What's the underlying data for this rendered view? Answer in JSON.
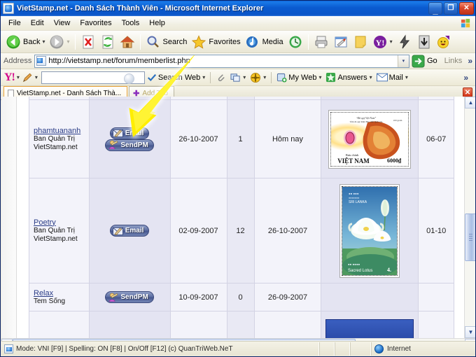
{
  "window": {
    "title": "VietStamp.net - Danh Sách Thành Viên - Microsoft Internet Explorer",
    "app_icon": "ie-page-icon",
    "minimize_label": "_",
    "restore_label": "❐",
    "close_label": "✕"
  },
  "menu": {
    "items": [
      {
        "label": "File"
      },
      {
        "label": "Edit"
      },
      {
        "label": "View"
      },
      {
        "label": "Favorites"
      },
      {
        "label": "Tools"
      },
      {
        "label": "Help"
      }
    ],
    "flag_icon": "windows-flag-icon"
  },
  "toolbar": {
    "back_label": "Back",
    "back_icon": "back-arrow-icon",
    "forward_icon": "forward-arrow-icon",
    "stop_icon": "stop-icon",
    "refresh_icon": "refresh-icon",
    "home_icon": "home-icon",
    "search_label": "Search",
    "search_icon": "magnifier-icon",
    "favorites_label": "Favorites",
    "favorites_icon": "star-icon",
    "media_label": "Media",
    "media_icon": "media-icon",
    "history_icon": "history-icon",
    "print_icon": "printer-icon",
    "edit_icon": "edit-page-icon",
    "note_icon": "note-icon",
    "yahoo_icon": "yahoo-icon",
    "messenger_icon": "messenger-icon",
    "download_icon": "download-icon",
    "emoticon_icon": "smiley-icon",
    "dropdown_caret": "▾"
  },
  "address": {
    "label": "Address",
    "url": "http://vietstamp.net/forum/memberlist.php",
    "page_icon": "page-icon",
    "dropdown_caret": "▾",
    "go_label": "Go",
    "go_icon": "go-arrow-icon",
    "links_label": "Links",
    "overflow_caret": "»"
  },
  "yahoo_toolbar": {
    "logo": "Y!",
    "logo_caret": "▾",
    "pencil_icon": "pencil-icon",
    "pencil_caret": "▾",
    "search_value": "",
    "search_placeholder": "",
    "check_icon": "check-icon",
    "search_web_label": "Search Web",
    "search_web_caret": "▾",
    "clip_icon": "paperclip-icon",
    "popup_icon": "popup-blocker-icon",
    "popup_caret": "▾",
    "antispy_icon": "anti-spy-icon",
    "antispy_caret": "▾",
    "myweb_label": "My Web",
    "myweb_icon": "myweb-icon",
    "myweb_caret": "▾",
    "answers_label": "Answers",
    "answers_icon": "answers-icon",
    "answers_caret": "▾",
    "mail_label": "Mail",
    "mail_icon": "mail-icon",
    "mail_caret": "▾",
    "overflow_caret": "»"
  },
  "tabstrip": {
    "tabs": [
      {
        "label": "VietStamp.net - Danh Sách Thà...",
        "active": true,
        "icon": "page-icon"
      },
      {
        "label": "Add Tab",
        "active": false,
        "icon": "plus-icon"
      }
    ],
    "close_label": "✕"
  },
  "memberlist": {
    "rows": [
      {
        "username": "phamtuananh",
        "role_line1": "Ban Quản Trị",
        "role_line2": "VietStamp.net",
        "actions": [
          {
            "label": "Email",
            "icon": "email-icon"
          },
          {
            "label": "SendPM",
            "icon": "sendpm-icon"
          }
        ],
        "join_date": "26-10-2007",
        "posts": "1",
        "last_visit": "Hôm nay",
        "stamp_alt": "vietnam-ruby-stamp",
        "stamp_caption_top": "\"Đá quý Việt Nam\"",
        "stamp_caption_sub": "Tem đá quý Rubi Bảo chất Quốc gia",
        "stamp_weight": "100 gram",
        "stamp_issuer": "Bưu chính",
        "stamp_country": "VIỆT NAM",
        "stamp_value": "6000₫",
        "number": "06-07"
      },
      {
        "username": "Poetry",
        "role_line1": "Ban Quản Trị",
        "role_line2": "VietStamp.net",
        "actions": [
          {
            "label": "Email",
            "icon": "email-icon"
          }
        ],
        "join_date": "02-09-2007",
        "posts": "12",
        "last_visit": "26-10-2007",
        "stamp_alt": "sri-lanka-sacred-lotus-stamp",
        "stamp_country": "SRI LANKA",
        "stamp_caption_bottom": "Sacred Lotus",
        "stamp_value": "4.50",
        "number": "01-10"
      },
      {
        "username": "Relax",
        "role_line1": "Tem Sống",
        "role_line2": "",
        "actions": [
          {
            "label": "SendPM",
            "icon": "sendpm-icon"
          }
        ],
        "join_date": "10-09-2007",
        "posts": "0",
        "last_visit": "26-09-2007",
        "stamp_alt": "blue-stamp-partial",
        "number": ""
      }
    ]
  },
  "scrollbars": {
    "up_arrow": "▲",
    "down_arrow": "▼",
    "left_arrow": "◀",
    "right_arrow": "▶"
  },
  "statusbar": {
    "message": "Mode: VNI [F9] | Spelling: ON [F8] | On/Off [F12] (c) QuanTriWeb.NeT",
    "zone_label": "Internet",
    "zone_icon": "internet-zone-icon",
    "page_icon": "page-icon"
  },
  "annotation": {
    "arrow": "yellow-arrow-pointing-down-left",
    "color": "#ffee00"
  }
}
